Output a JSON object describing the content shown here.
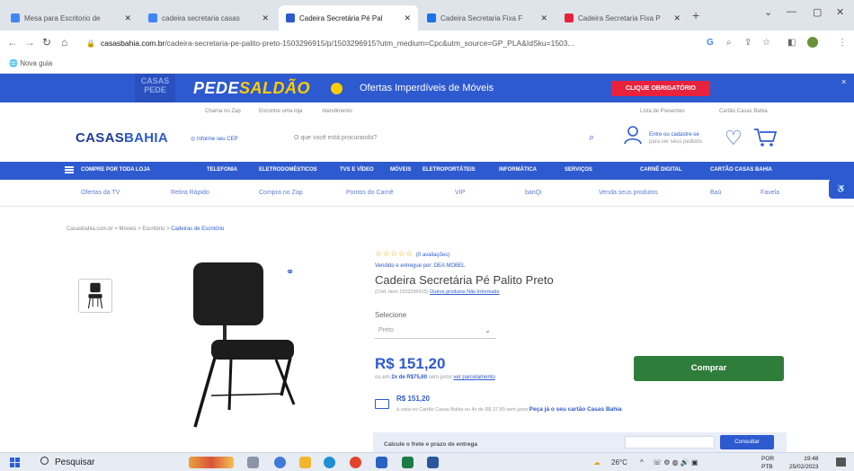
{
  "browser": {
    "tabs": [
      {
        "title": "Mesa para Escritorio de",
        "favicon_color": "#4285f4"
      },
      {
        "title": "cadeira secretaria casas",
        "favicon_color": "#4285f4"
      },
      {
        "title": "Cadeira Secretária Pé Pal",
        "favicon_color": "#2e5ad0"
      },
      {
        "title": "Cadeira Secretaria Fixa F",
        "favicon_color": "#1a73e8"
      },
      {
        "title": "Cadeira Secretaria Fixa P",
        "favicon_color": "#e8223c"
      }
    ],
    "active_tab_index": 2,
    "new_tab": "+",
    "url_host": "casasbahia.com.br",
    "url_path": "/cadeira-secretaria-pe-palito-preto-1503296915/p/1503296915?utm_medium=Cpc&utm_source=GP_PLA&IdSku=1503...",
    "bookmark": "Nova guia"
  },
  "promo": {
    "logo": "CASAS PEDE",
    "title_a": "PEDE",
    "title_b": "SALDÃO",
    "text": "Ofertas Imperdíveis de Móveis",
    "cta": "CLIQUE OBRIGATÓRIO",
    "close": "×"
  },
  "utility": {
    "links": [
      "Chama no Zap",
      "Encontre uma loja",
      "Atendimento"
    ],
    "right_links": [
      "Lista de Presentes",
      "Cartão Casas Bahia"
    ]
  },
  "header": {
    "brand_a": "CASAS",
    "brand_b": "BAHIA",
    "location": "Informe seu CEP",
    "search_placeholder": "O que você está procurando?",
    "login_line1": "Entre ou cadastre-se",
    "login_line2": "para ver seus pedidos"
  },
  "categories": {
    "all": "COMPRE POR TODA LOJA",
    "items": [
      "TELEFONIA",
      "ELETRODOMÉSTICOS",
      "TVS E VÍDEO",
      "MÓVEIS",
      "ELETROPORTÁTEIS",
      "INFORMÁTICA",
      "SERVIÇOS",
      "CARNÊ DIGITAL",
      "CARTÃO CASAS BAHIA"
    ]
  },
  "sublinks": [
    "Ofertas da TV",
    "Retira Rápido",
    "Compra no Zap",
    "Pontos do Carnê",
    "VIP",
    "banQi",
    "Venda seus produtos",
    "Baú",
    "Favela"
  ],
  "breadcrumb": {
    "items": [
      "Casasbahia.com.br",
      "Móveis",
      "Escritório"
    ],
    "current": "Cadeiras de Escritório"
  },
  "product": {
    "stars": "☆☆☆☆☆",
    "reviews": "(0 avaliações)",
    "seller": "Vendido e entregue por: DEA MOBEL",
    "title": "Cadeira Secretária Pé Palito Preto",
    "code": "(Cód. Item 1503296915)",
    "other_sellers": "Outros produtos Não Informado",
    "select_label": "Selecione",
    "select_value": "Preto",
    "price": "R$ 151,20",
    "installments_prefix": "ou em",
    "installments": "2x de R$75,60",
    "installments_suffix": "sem juros",
    "installments_link": "ver parcelamento",
    "buy_label": "Comprar",
    "card_price": "R$ 151,20",
    "card_text": "à vista no Cartão Casas Bahia ou 4x de R$ 37,80 sem juros",
    "card_link": "Peça já o seu cartão Casas Bahia",
    "shipping_label": "Calcule o frete e prazo de entrega",
    "consult": "Consultar"
  },
  "taskbar": {
    "search": "Pesquisar",
    "weather": "26°C",
    "lang_a": "POR",
    "lang_b": "PTB",
    "time": "19:48",
    "date": "25/02/2023"
  },
  "colors": {
    "brand_blue": "#2e5ad0",
    "buy_green": "#2f7d3b",
    "cta_red": "#e8223c",
    "star": "#f0a800"
  }
}
